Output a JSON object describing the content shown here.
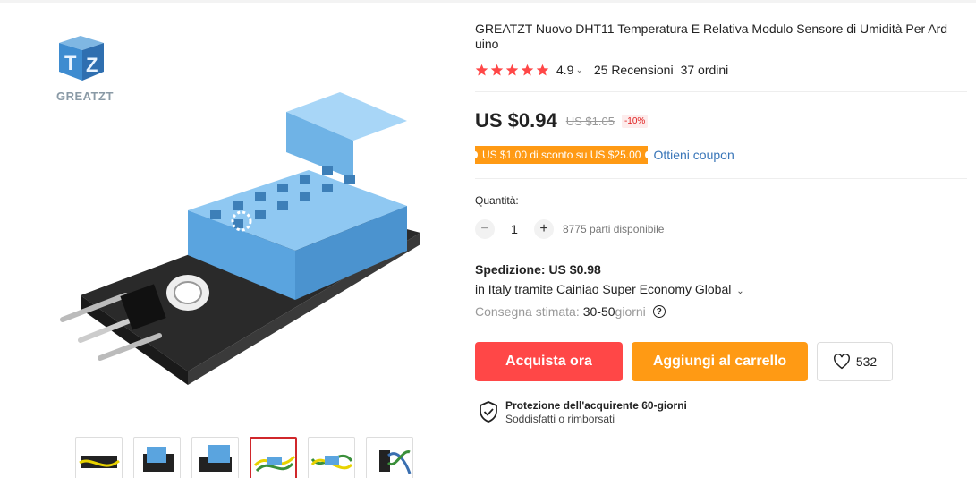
{
  "brand": {
    "name": "GREATZT"
  },
  "product": {
    "title": "GREATZT Nuovo DHT11 Temperatura E Relativa Modulo Sensore di Umidità Per Ard uino",
    "rating": "4.9",
    "reviews": "25 Recensioni",
    "orders": "37 ordini"
  },
  "pricing": {
    "price": "US $0.94",
    "old_price": "US $1.05",
    "discount": "-10%",
    "coupon": "US $1.00 di sconto su US $25.00",
    "coupon_link": "Ottieni coupon"
  },
  "quantity": {
    "label": "Quantità:",
    "minus": "−",
    "value": "1",
    "plus": "+",
    "available": "8775 parti disponibile"
  },
  "shipping": {
    "title": "Spedizione: US $0.98",
    "method": "in Italy tramite Cainiao Super Economy Global",
    "delivery_label": "Consegna stimata:",
    "delivery_days": "30-50",
    "delivery_unit": "giorni"
  },
  "actions": {
    "buy_now": "Acquista ora",
    "add_to_cart": "Aggiungi al carrello",
    "wishlist_count": "532"
  },
  "protection": {
    "title": "Protezione dell'acquirente 60-giorni",
    "subtitle": "Soddisfatti o rimborsati"
  },
  "colors": {
    "buy": "#ff4747",
    "cart": "#ff9a14",
    "link": "#3875b8",
    "star": "#ff4747"
  },
  "icons": [
    "star-icon",
    "chevron-down-icon",
    "question-icon",
    "heart-icon",
    "shield-check-icon"
  ]
}
